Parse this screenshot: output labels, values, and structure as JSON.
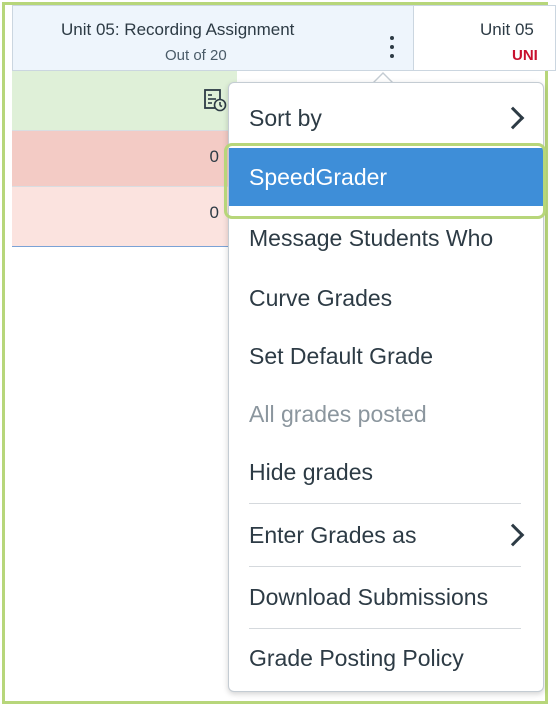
{
  "columns": [
    {
      "title": "Unit 05: Recording Assignment",
      "subtitle": "Out of 20"
    },
    {
      "title": "Unit 05",
      "subtitle": "UNI"
    }
  ],
  "cells": [
    {
      "value": "0"
    },
    {
      "value": "0"
    }
  ],
  "menu": {
    "items": [
      {
        "label": "Sort by",
        "has_submenu": true
      },
      {
        "label": "SpeedGrader",
        "active": true
      },
      {
        "label": "Message Students Who"
      },
      {
        "label": "Curve Grades"
      },
      {
        "label": "Set Default Grade"
      },
      {
        "label": "All grades posted",
        "disabled": true
      },
      {
        "label": "Hide grades"
      },
      {
        "label": "Enter Grades as",
        "has_submenu": true
      },
      {
        "label": "Download Submissions"
      },
      {
        "label": "Grade Posting Policy"
      }
    ]
  },
  "colors": {
    "highlight_outline": "#b7d67a",
    "active_item": "#3e8ed8",
    "status_red": "#c8102e"
  }
}
